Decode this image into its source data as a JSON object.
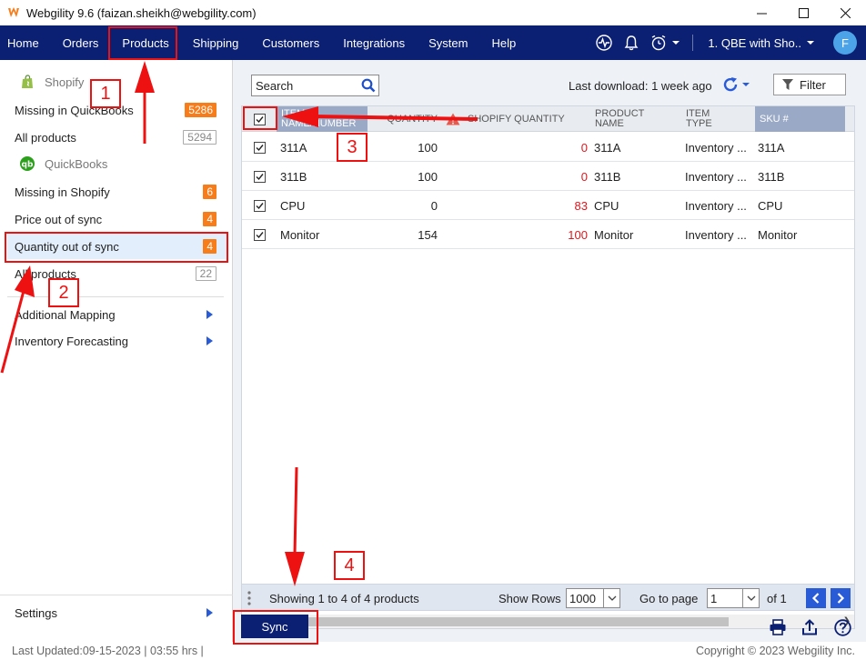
{
  "window": {
    "title": "Webgility 9.6 (faizan.sheikh@webgility.com)",
    "controls": [
      "minimize",
      "maximize",
      "close"
    ]
  },
  "nav": {
    "items": [
      "Home",
      "Orders",
      "Products",
      "Shipping",
      "Customers",
      "Integrations",
      "System",
      "Help"
    ],
    "active": "Products",
    "company": "1. QBE with Sho..",
    "avatar_letter": "F"
  },
  "sidebar": {
    "shopify_group": "Shopify",
    "quickbooks_group": "QuickBooks",
    "items": [
      {
        "label": "Missing in QuickBooks",
        "badge": "5286"
      },
      {
        "label": "All products",
        "badge": "5294"
      },
      {
        "label": "Missing in Shopify",
        "badge": "6"
      },
      {
        "label": "Price out of sync",
        "badge": "4"
      },
      {
        "label": "Quantity out of sync",
        "badge": "4"
      },
      {
        "label": "All products",
        "badge": "22"
      }
    ],
    "expandables": [
      "Additional Mapping",
      "Inventory Forecasting"
    ],
    "settings": "Settings",
    "active_item": "Quantity out of sync"
  },
  "toolbar": {
    "search_placeholder": "Search",
    "last_download": "Last download: 1 week ago",
    "filter_label": "Filter"
  },
  "grid": {
    "columns": {
      "item_name_line1": "ITEM",
      "item_name_line2": "NAME/NUMBER",
      "quantity": "QUANTITY",
      "shopify_qty": "SHOPIFY QUANTITY",
      "product_name_line1": "PRODUCT",
      "product_name_line2": "NAME",
      "item_type_line1": "ITEM",
      "item_type_line2": "TYPE",
      "sku": "SKU #"
    },
    "rows": [
      {
        "item": "311A",
        "qty": "100",
        "shopify_qty": "0",
        "product": "311A",
        "type": "Inventory ...",
        "sku": "311A",
        "checked": true
      },
      {
        "item": "311B",
        "qty": "100",
        "shopify_qty": "0",
        "product": "311B",
        "type": "Inventory ...",
        "sku": "311B",
        "checked": true
      },
      {
        "item": "CPU",
        "qty": "0",
        "shopify_qty": "83",
        "product": "CPU",
        "type": "Inventory ...",
        "sku": "CPU",
        "checked": true
      },
      {
        "item": "Monitor",
        "qty": "154",
        "shopify_qty": "100",
        "product": "Monitor",
        "type": "Inventory ...",
        "sku": "Monitor",
        "checked": true
      }
    ]
  },
  "pager": {
    "showing": "Showing 1 to 4 of 4 products",
    "show_rows_label": "Show Rows",
    "show_rows_value": "1000",
    "goto_label": "Go to page",
    "goto_value": "1",
    "of_label": "of 1"
  },
  "actions": {
    "sync_label": "Sync"
  },
  "status": {
    "last_updated": "Last Updated:09-15-2023 | 03:55 hrs |",
    "copyright": "Copyright © 2023 Webgility Inc."
  },
  "annotations": [
    "1",
    "2",
    "3",
    "4"
  ],
  "colors": {
    "nav_bg": "#0b1f73",
    "badge_orange": "#f77c1a",
    "accent_blue": "#2a5bd7",
    "annotation_red": "#ee1111",
    "negative_red": "#e0161e"
  }
}
